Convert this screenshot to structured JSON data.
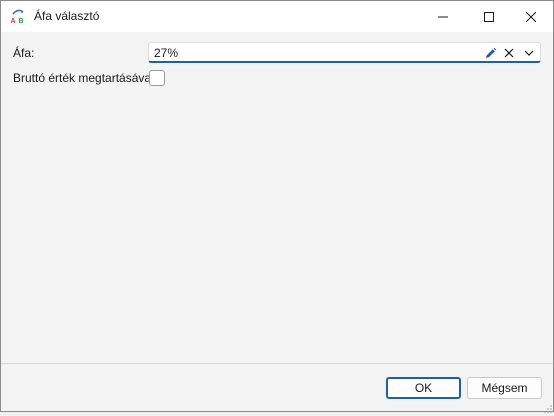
{
  "window": {
    "title": "Áfa választó",
    "icon": "ab-text-icon"
  },
  "form": {
    "vat_label": "Áfa:",
    "vat_value": "27%",
    "gross_label": "Bruttó érték megtartásával",
    "gross_checked": false
  },
  "buttons": {
    "ok": "OK",
    "cancel": "Mégsem"
  },
  "colors": {
    "accent": "#1f5fa8",
    "icon_red": "#d9362b",
    "icon_blue": "#2b6cc4",
    "icon_green": "#2f9a3f"
  }
}
